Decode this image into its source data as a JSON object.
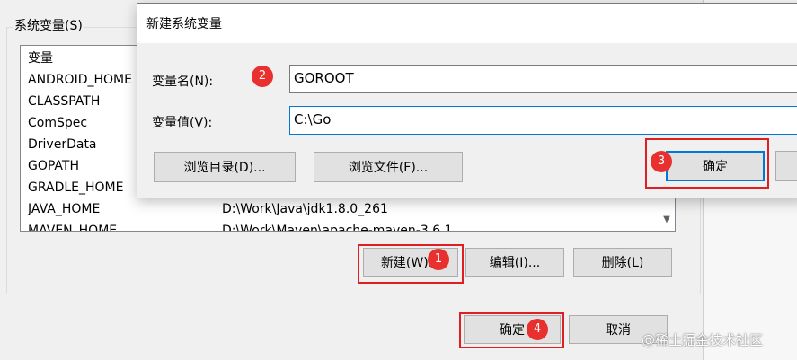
{
  "parent": {
    "group_label": "系统变量(S)",
    "list_header": "变量",
    "variables": [
      {
        "name": "ANDROID_HOME",
        "value": ""
      },
      {
        "name": "CLASSPATH",
        "value": ""
      },
      {
        "name": "ComSpec",
        "value": ""
      },
      {
        "name": "DriverData",
        "value": ""
      },
      {
        "name": "GOPATH",
        "value": ""
      },
      {
        "name": "GRADLE_HOME",
        "value": ""
      },
      {
        "name": "JAVA_HOME",
        "value": "D:\\Work\\Java\\jdk1.8.0_261"
      },
      {
        "name": "MAVEN_HOME",
        "value": "D:\\Work\\Maven\\apache-maven-3.6.1"
      }
    ],
    "buttons": {
      "new": "新建(W)...",
      "edit": "编辑(I)...",
      "delete": "删除(L)"
    },
    "footer": {
      "ok": "确定",
      "cancel": "取消"
    }
  },
  "dialog": {
    "title": "新建系统变量",
    "name_label": "变量名(N):",
    "name_value": "GOROOT",
    "value_label": "变量值(V):",
    "value_value": "C:\\Go",
    "browse_dir": "浏览目录(D)...",
    "browse_file": "浏览文件(F)...",
    "ok": "确定"
  },
  "annotations": {
    "step1": "1",
    "step2": "2",
    "step3": "3",
    "step4": "4"
  },
  "watermark": "@稀土掘金技术社区",
  "colors": {
    "annotation_red": "#e02020",
    "focus_blue": "#0078d7"
  }
}
